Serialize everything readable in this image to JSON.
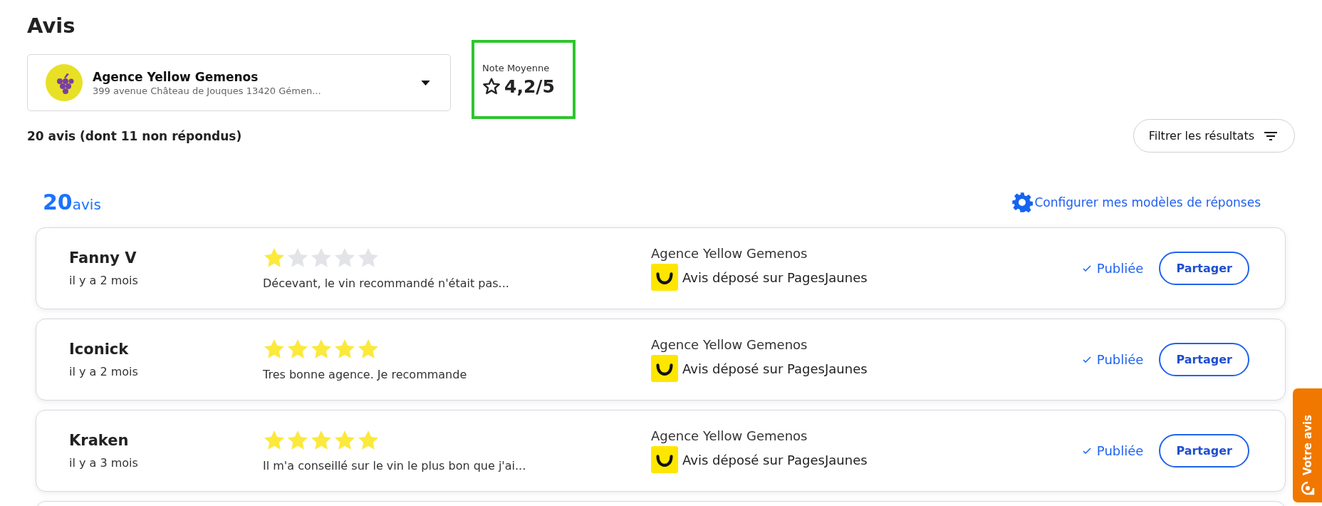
{
  "title": "Avis",
  "agency_select": {
    "name": "Agence Yellow Gemenos",
    "address": "399 avenue Château de Jouques 13420 Gémen..."
  },
  "average": {
    "label": "Note Moyenne",
    "value": "4,2/5"
  },
  "summary": "20 avis (dont 11 non répondus)",
  "filter_button": "Filtrer les résultats",
  "count": {
    "number": "20",
    "unit": "avis"
  },
  "configure_link": "Configurer mes modèles de réponses",
  "reviews": [
    {
      "author": "Fanny V",
      "date": "il y a 2 mois",
      "stars": 1,
      "text": "Décevant, le vin recommandé n'était pas...",
      "agency": "Agence Yellow Gemenos",
      "source": "Avis déposé sur PagesJaunes",
      "status": "Publiée",
      "action": "Partager"
    },
    {
      "author": "Iconick",
      "date": "il y a 2 mois",
      "stars": 5,
      "text": "Tres bonne agence. Je recommande",
      "agency": "Agence Yellow Gemenos",
      "source": "Avis déposé sur PagesJaunes",
      "status": "Publiée",
      "action": "Partager"
    },
    {
      "author": "Kraken",
      "date": "il y a 3 mois",
      "stars": 5,
      "text": "Il m'a conseillé sur le vin le plus bon que j'ai...",
      "agency": "Agence Yellow Gemenos",
      "source": "Avis déposé sur PagesJaunes",
      "status": "Publiée",
      "action": "Partager"
    }
  ],
  "feedback_tab": "Votre avis"
}
